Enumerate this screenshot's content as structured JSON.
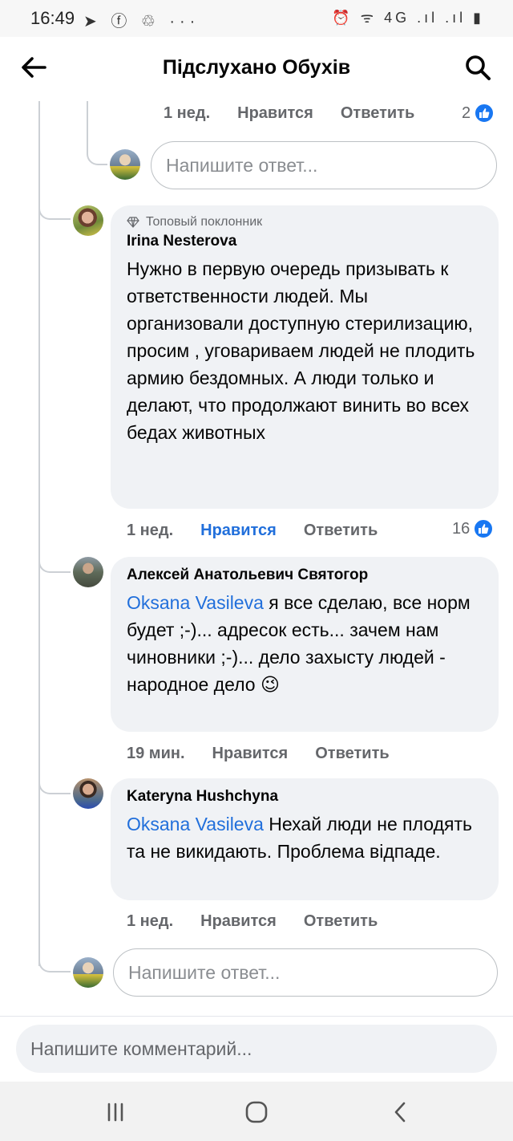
{
  "status_bar": {
    "time": "16:49",
    "left_icons": "➤ ⓕ ♲ ···",
    "right_icons": "⏰ ᯤ 4G .ıl .ıl ▮"
  },
  "header": {
    "title": "Підслухано Обухів",
    "back_icon": "arrow-left-icon",
    "search_icon": "search-icon"
  },
  "top_actions": {
    "time": "1 нед.",
    "like": "Нравится",
    "reply": "Ответить",
    "reactions": "2"
  },
  "reply_placeholder": "Напишите ответ...",
  "comments": [
    {
      "badge": "Топовый поклонник",
      "author": "Irina Nesterova",
      "text": "Нужно в первую очередь призывать к ответственности людей. Мы организовали доступную стерилизацию, просим , уговариваем людей не плодить армию бездомных. А люди только и делают, что продолжают винить во всех бедах животных",
      "time": "1 нед.",
      "like": "Нравится",
      "reply": "Ответить",
      "reactions": "16"
    },
    {
      "author": "Алексей Анатольевич Святогор",
      "mention": "Oksana Vasileva",
      "text": " я все сделаю, все норм будет ;-)... адресок есть... зачем нам чиновники ;-)... дело захысту людей - народное дело",
      "emoji": "😉",
      "time": "19 мин.",
      "like": "Нравится",
      "reply": "Ответить"
    },
    {
      "author": "Kateryna Hushchyna",
      "mention": "Oksana Vasileva",
      "text": " Нехай люди не плодять та не викидають. Проблема відпаде.",
      "time": "1 нед.",
      "like": "Нравится",
      "reply": "Ответить"
    }
  ],
  "bottom": {
    "comment_placeholder": "Напишите комментарий..."
  },
  "colors": {
    "accent": "#216fdb",
    "like_badge": "#1877f2",
    "bubble": "#f0f2f5",
    "secondary_text": "#65676b"
  }
}
